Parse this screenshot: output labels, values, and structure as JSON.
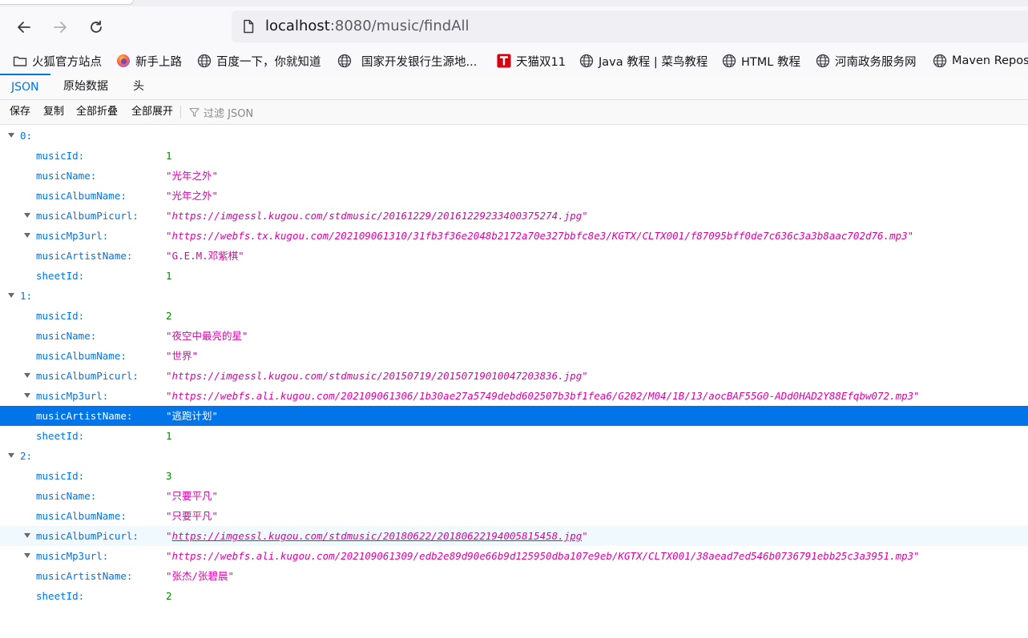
{
  "browser": {
    "url_host": "localhost",
    "url_path": ":8080/music/findAll"
  },
  "bookmarks": [
    {
      "label": "火狐官方站点",
      "icon": "folder-icon"
    },
    {
      "label": "新手上路",
      "icon": "firefox-icon"
    },
    {
      "label": "百度一下，你就知道",
      "icon": "globe-icon"
    },
    {
      "label": "国家开发银行生源地...",
      "icon": "globe-icon"
    },
    {
      "label": "天猫双11",
      "icon": "tmall-icon"
    },
    {
      "label": "Java 教程 | 菜鸟教程",
      "icon": "globe-icon"
    },
    {
      "label": "HTML 教程",
      "icon": "globe-icon"
    },
    {
      "label": "河南政务服务网",
      "icon": "globe-icon"
    },
    {
      "label": "Maven Repos",
      "icon": "globe-icon"
    }
  ],
  "viewer": {
    "tabs": [
      "JSON",
      "原始数据",
      "头"
    ],
    "toolbar": {
      "save": "保存",
      "copy": "复制",
      "collapse_all": "全部折叠",
      "expand_all": "全部展开",
      "filter_placeholder": "过滤 JSON"
    }
  },
  "json_items": [
    {
      "index": "0:",
      "fields": [
        {
          "key": "musicId:",
          "value": "1"
        },
        {
          "key": "musicName:",
          "value": "\"光年之外\""
        },
        {
          "key": "musicAlbumName:",
          "value": "\"光年之外\""
        },
        {
          "key": "musicAlbumPicurl:",
          "value": "\"https://imgessl.kugou.com/stdmusic/20161229/20161229233400375274.jpg\""
        },
        {
          "key": "musicMp3url:",
          "value": "\"https://webfs.tx.kugou.com/202109061310/31fb3f36e2048b2172a70e327bbfc8e3/KGTX/CLTX001/f87095bff0de7c636c3a3b8aac702d76.mp3\""
        },
        {
          "key": "musicArtistName:",
          "value": "\"G.E.M.邓紫棋\""
        },
        {
          "key": "sheetId:",
          "value": "1"
        }
      ]
    },
    {
      "index": "1:",
      "fields": [
        {
          "key": "musicId:",
          "value": "2"
        },
        {
          "key": "musicName:",
          "value": "\"夜空中最亮的星\""
        },
        {
          "key": "musicAlbumName:",
          "value": "\"世界\""
        },
        {
          "key": "musicAlbumPicurl:",
          "value": "\"https://imgessl.kugou.com/stdmusic/20150719/20150719010047203836.jpg\""
        },
        {
          "key": "musicMp3url:",
          "value": "\"https://webfs.ali.kugou.com/202109061306/1b30ae27a5749debd602507b3bf1fea6/G202/M04/1B/13/aocBAF55G0-ADd0HAD2Y88Efqbw072.mp3\""
        },
        {
          "key": "musicArtistName:",
          "value": "\"逃跑计划\""
        },
        {
          "key": "sheetId:",
          "value": "1"
        }
      ]
    },
    {
      "index": "2:",
      "fields": [
        {
          "key": "musicId:",
          "value": "3"
        },
        {
          "key": "musicName:",
          "value": "\"只要平凡\""
        },
        {
          "key": "musicAlbumName:",
          "value": "\"只要平凡\""
        },
        {
          "key": "musicAlbumPicurl:",
          "value": "https://imgessl.kugou.com/stdmusic/20180622/20180622194005815458.jpg"
        },
        {
          "key": "musicMp3url:",
          "value": "\"https://webfs.ali.kugou.com/202109061309/edb2e89d90e66b9d125950dba107e9eb/KGTX/CLTX001/38aead7ed546b0736791ebb25c3a3951.mp3\""
        },
        {
          "key": "musicArtistName:",
          "value": "\"张杰/张碧晨\""
        },
        {
          "key": "sheetId:",
          "value": "2"
        }
      ]
    }
  ]
}
